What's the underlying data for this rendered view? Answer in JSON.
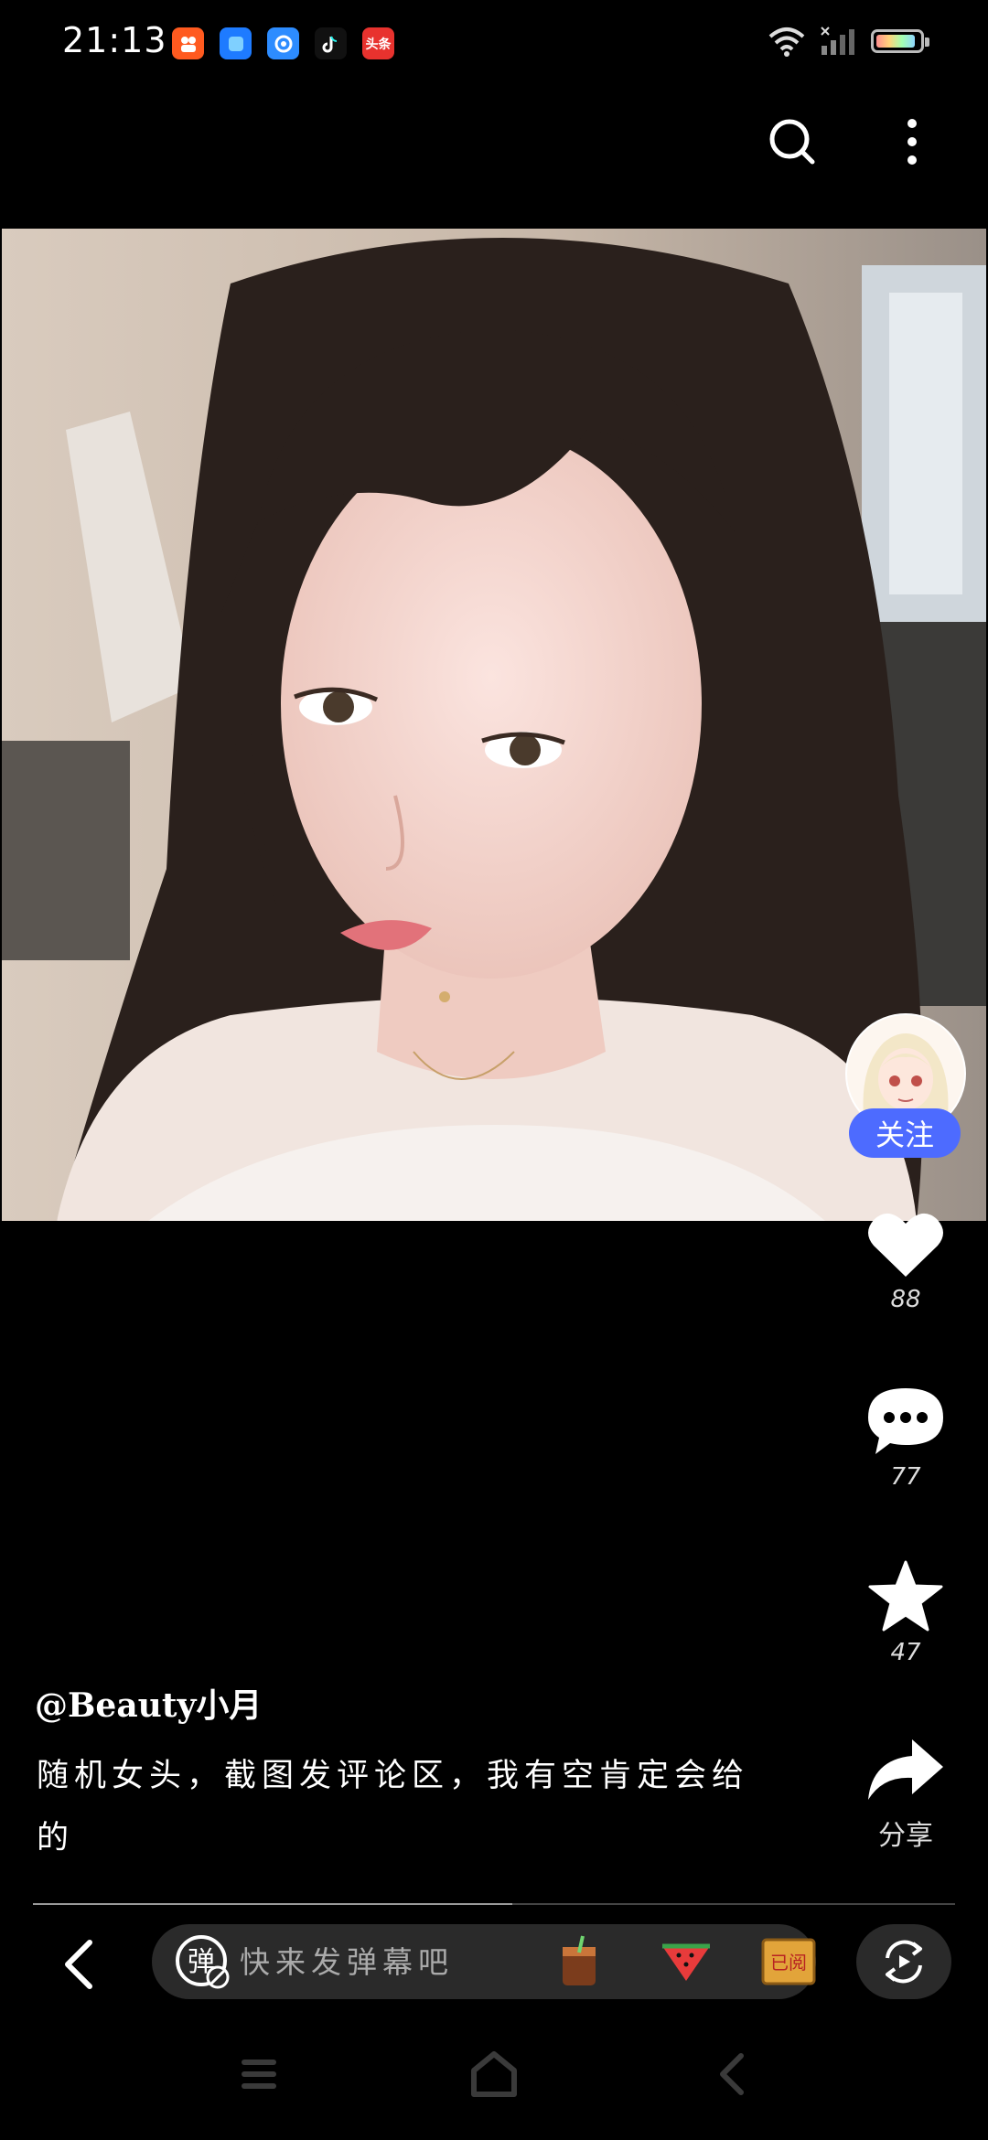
{
  "status_bar": {
    "time": "21:13",
    "apps": [
      {
        "name": "kuaishou-icon",
        "label": "",
        "color": "#ff5a1f"
      },
      {
        "name": "blue-app-icon",
        "label": "",
        "color": "#1e7bff"
      },
      {
        "name": "browser-icon",
        "label": "",
        "color": "#2d8cff"
      },
      {
        "name": "tiktok-icon",
        "label": "",
        "color": "#111"
      },
      {
        "name": "toutiao-icon",
        "label": "头条",
        "color": "#e8322e"
      }
    ],
    "battery_level": 0.92
  },
  "post": {
    "author": "@Beauty小月",
    "caption": "随机女头，截图发评论区，我有空肯定会给的",
    "follow_label": "关注",
    "likes": "88",
    "comments": "77",
    "favorites": "47",
    "share_label": "分享",
    "progress": 0.52
  },
  "danmaku": {
    "placeholder": "快来发弹幕吧",
    "badge_label": "弹",
    "stamp_label": "已阅"
  },
  "colors": {
    "accent": "#4d6bff",
    "background": "#000000"
  }
}
